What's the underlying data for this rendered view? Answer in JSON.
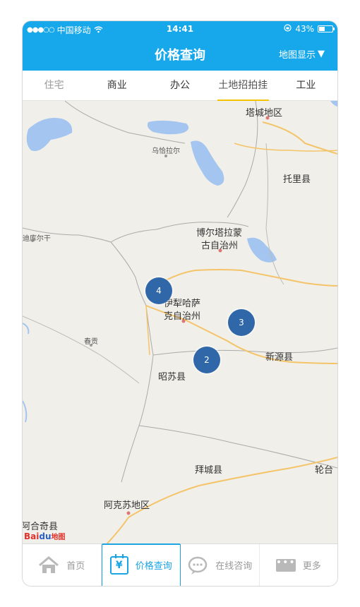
{
  "status_bar": {
    "carrier": "中国移动",
    "time": "14:41",
    "battery": "43%",
    "battery_level": 0.43
  },
  "nav": {
    "title": "价格查询",
    "map_toggle": "地图显示",
    "map_toggle_arrow": "▼"
  },
  "category_tabs": [
    {
      "label": "住宅"
    },
    {
      "label": "商业"
    },
    {
      "label": "办公"
    },
    {
      "label": "土地招拍挂"
    },
    {
      "label": "工业"
    }
  ],
  "map": {
    "places": {
      "tacheng": "塔城地区",
      "wuqiala": "乌恰拉尔",
      "tuoli": "托里县",
      "diku": "(迪库尔干",
      "boertala_1": "博尔塔拉蒙",
      "boertala_2": "古自治州",
      "yili_1": "伊犁哈萨",
      "yili_2": "克自治州",
      "chungong": "春贡",
      "xinyuan": "新源县",
      "zhaosu": "昭苏县",
      "baicheng": "拜城县",
      "luntai": "轮台",
      "akesu": "阿克苏地区",
      "aheqi": "阿合奇县"
    },
    "clusters": [
      {
        "count": "4"
      },
      {
        "count": "3"
      },
      {
        "count": "2"
      }
    ],
    "logo": {
      "part1": "Bai",
      "part2": "du",
      "part3": "地图"
    }
  },
  "bottom_nav": [
    {
      "label": "首页",
      "icon": "home-icon"
    },
    {
      "label": "价格查询",
      "icon": "price-calendar-icon"
    },
    {
      "label": "在线咨询",
      "icon": "chat-icon"
    },
    {
      "label": "更多",
      "icon": "more-icon"
    }
  ],
  "colors": {
    "brand": "#16a8ea",
    "cluster": "#2f67a8",
    "tab_underline": "#f4c400",
    "water": "#a3c5f0",
    "road": "#f4c46a"
  }
}
